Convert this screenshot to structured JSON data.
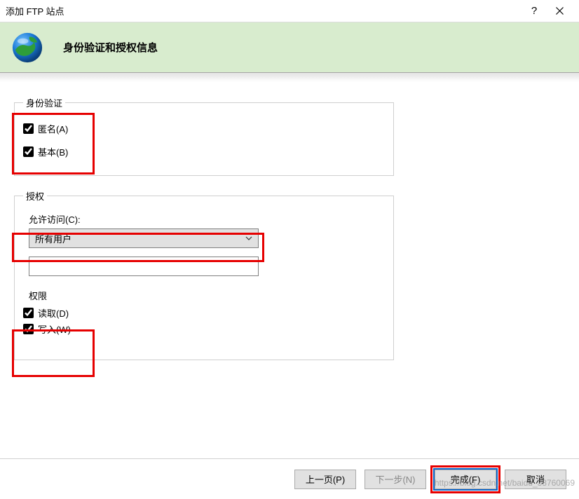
{
  "window": {
    "title": "添加 FTP 站点"
  },
  "header": {
    "title": "身份验证和授权信息"
  },
  "auth": {
    "legend": "身份验证",
    "anonymous_label": "匿名(A)",
    "anonymous_checked": true,
    "basic_label": "基本(B)",
    "basic_checked": true
  },
  "authorizationPanel": {
    "legend": "授权",
    "allow_access_label": "允许访问(C):",
    "allow_access_value": "所有用户",
    "roles_text": "",
    "permissions_label": "权限",
    "read_label": "读取(D)",
    "read_checked": true,
    "write_label": "写入(W)",
    "write_checked": true
  },
  "buttons": {
    "prev": "上一页(P)",
    "next": "下一步(N)",
    "finish": "完成(F)",
    "cancel": "取消"
  },
  "watermark": "https://blog.csdn.net/baidu_38760069"
}
